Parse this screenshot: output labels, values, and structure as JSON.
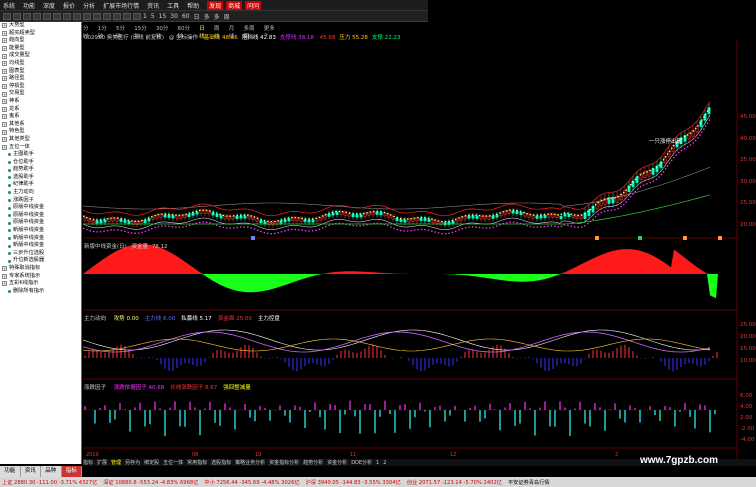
{
  "menu": [
    "系统",
    "功能",
    "深度",
    "报价",
    "分析",
    "扩展市场行情",
    "资讯",
    "工具",
    "帮助"
  ],
  "menu_tags": {
    "tag1": "发现",
    "tag2": "商城",
    "tag3": "问问"
  },
  "toolbar_numbers": [
    "1",
    "5",
    "15",
    "30",
    "60",
    "日",
    "多",
    "多",
    "周"
  ],
  "sidebar": {
    "items": [
      {
        "label": "大势型",
        "type": "group"
      },
      {
        "label": "超买超卖型",
        "type": "group"
      },
      {
        "label": "趋向型",
        "type": "group"
      },
      {
        "label": "能量型",
        "type": "group"
      },
      {
        "label": "成交量型",
        "type": "group"
      },
      {
        "label": "均线型",
        "type": "group"
      },
      {
        "label": "图表型",
        "type": "group"
      },
      {
        "label": "路径型",
        "type": "group"
      },
      {
        "label": "停损型",
        "type": "group"
      },
      {
        "label": "交易型",
        "type": "group"
      },
      {
        "label": "神系",
        "type": "group"
      },
      {
        "label": "龙系",
        "type": "group"
      },
      {
        "label": "鬼系",
        "type": "group"
      },
      {
        "label": "其他系",
        "type": "group"
      },
      {
        "label": "特色型",
        "type": "group"
      },
      {
        "label": "其他类型",
        "type": "group"
      },
      {
        "label": "五位一体",
        "type": "group"
      },
      {
        "label": "主图助手",
        "type": "leaf"
      },
      {
        "label": "仓位助手",
        "type": "leaf"
      },
      {
        "label": "趋势助手",
        "type": "leaf"
      },
      {
        "label": "选股助手",
        "type": "leaf"
      },
      {
        "label": "纪律助手",
        "type": "leaf"
      },
      {
        "label": "主力动向",
        "type": "leaf"
      },
      {
        "label": "涨跌因子",
        "type": "leaf"
      },
      {
        "label": "原版中线资金",
        "type": "leaf"
      },
      {
        "label": "原版中线资金",
        "type": "leaf"
      },
      {
        "label": "原版中线资金",
        "type": "leaf"
      },
      {
        "label": "新版中线资金",
        "type": "leaf"
      },
      {
        "label": "新版中线资金",
        "type": "leaf"
      },
      {
        "label": "新版中线资金",
        "type": "leaf"
      },
      {
        "label": "三步升位选股",
        "type": "leaf"
      },
      {
        "label": "升位新选股器",
        "type": "leaf"
      },
      {
        "label": "特殊取消指标",
        "type": "group"
      },
      {
        "label": "专家系统指示",
        "type": "group"
      },
      {
        "label": "五彩K线指示",
        "type": "group"
      },
      {
        "label": "删除所有指示",
        "type": "leaf"
      }
    ],
    "tabs": [
      "功能",
      "资讯",
      "品种",
      "指标"
    ]
  },
  "chart": {
    "periods": [
      "分时",
      "1分钟",
      "5分钟",
      "15分钟",
      "30分钟",
      "60分钟",
      "日线",
      "周线",
      "月线",
      "多周期",
      "更多>"
    ],
    "main_title": "002950 奥美医疗 (日线 前复权)",
    "indicator_name": "@ 坐标操作",
    "indicator_values": [
      {
        "label": "基础线",
        "value": "48.66",
        "color": "#ffcc00"
      },
      {
        "label": "阻挡线",
        "value": "42.83",
        "color": "#ffffff"
      },
      {
        "label": "支撑线",
        "value": "38.18",
        "color": "#cc33ff"
      },
      {
        "label": "",
        "value": "45.68",
        "color": "#ff3333"
      },
      {
        "label": "压力",
        "value": "55.28",
        "color": "#ffcc00"
      },
      {
        "label": "支撑",
        "value": "22.23",
        "color": "#00ff66"
      }
    ],
    "price_axis": [
      "45.00",
      "40.00",
      "35.00",
      "30.00",
      "25.00",
      "20.00"
    ],
    "annotation": "一只涨停出现",
    "sub1_title": "新版中线资金(日)",
    "sub1_value_label": "资金量",
    "sub1_value": "78.12",
    "sub2_title": "主力动向",
    "sub2_items": [
      {
        "label": "攻势",
        "value": "0.00",
        "color": "#ffff66"
      },
      {
        "label": "主力线",
        "value": "6.00",
        "color": "#6666ff"
      },
      {
        "label": "私募线",
        "value": "5.17",
        "color": "#ffffff"
      },
      {
        "label": "资金面",
        "value": "25.00",
        "color": "#ff3333"
      },
      {
        "label": "主力控盘",
        "value": "",
        "color": "#ffffff"
      }
    ],
    "sub2_axis": [
      "25.00",
      "20.00",
      "15.00",
      "10.00"
    ],
    "sub3_title": "涨跌因子",
    "sub3_items": [
      {
        "label": "涨跌依据因子",
        "value": "40.68",
        "color": "#ff33ff"
      },
      {
        "label": "长线涨跌因子",
        "value": "8.67",
        "color": "#ff3333"
      },
      {
        "label": "强回整减量",
        "value": "",
        "color": "#ffff00"
      }
    ],
    "sub3_axis": [
      "6.00",
      "4.00",
      "2.00",
      "-2.00",
      "-4.00"
    ],
    "panel_labels": [
      "新版中线资金",
      "主力动向",
      "涨跌因子"
    ],
    "dates": [
      "2019年",
      "08",
      "10",
      "11",
      "12",
      "2"
    ]
  },
  "bottom_tabs": [
    "指标",
    "扩展",
    "管理",
    "另存为",
    "绑定股",
    "五位一体",
    "常用指标",
    "选股指标",
    "策略业务分析",
    "资金指标分析",
    "趋势分析",
    "资金分析",
    "DDE分析",
    "1",
    "2"
  ],
  "statusbar": [
    {
      "text": "上证 2880.30 -111.00 -3.71% 4327亿",
      "cls": "up"
    },
    {
      "text": "深证 10880.8 -553.24 -4.83% 6968亿",
      "cls": "up"
    },
    {
      "text": "中小 7256.44 -345.69 -4.48% 3026亿",
      "cls": "up"
    },
    {
      "text": "沪深 3940.05 -144.83 -3.55% 3304亿",
      "cls": "up"
    },
    {
      "text": "创业 2071.57 -123.14 -5.70% 2402亿",
      "cls": "up"
    },
    {
      "text": "平安证券青岛行情",
      "cls": ""
    }
  ],
  "watermark": "www.7gpzb.com"
}
